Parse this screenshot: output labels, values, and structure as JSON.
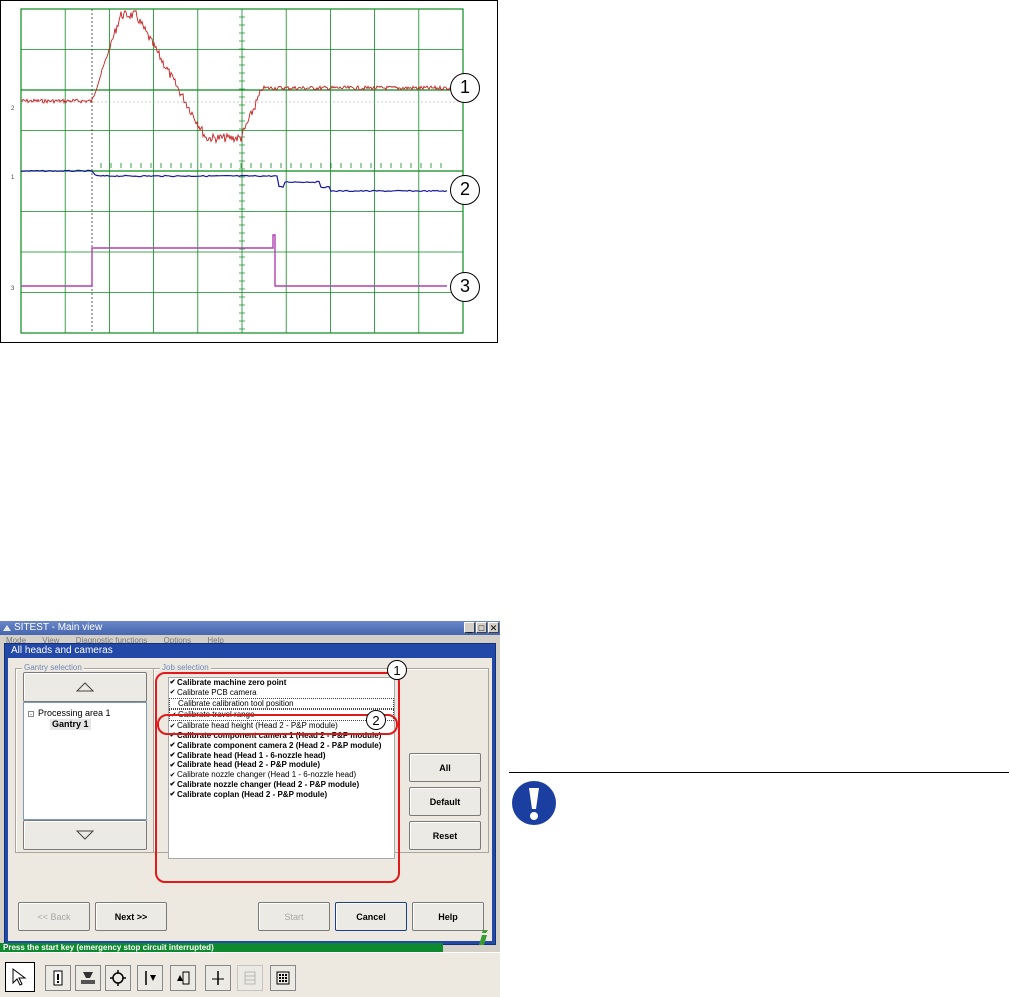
{
  "scope": {
    "callouts": [
      "1",
      "2",
      "3"
    ],
    "channel_markers": [
      "2",
      "1",
      "3"
    ],
    "colors": {
      "grid": "#0a8a1e",
      "trace1": "#c82020",
      "trace2": "#1a1aa0",
      "trace3": "#b040b0"
    }
  },
  "window": {
    "title": "SITEST - Main view",
    "menu": [
      "Mode",
      "View",
      "Diagnostic functions",
      "Options",
      "Help"
    ],
    "title_buttons": [
      "_",
      "□",
      "✕"
    ],
    "dialog": {
      "title": "All heads and cameras",
      "gantry": {
        "label": "Gantry selection",
        "up_icon": "triangle-up-icon",
        "down_icon": "triangle-down-icon",
        "tree_parent": "Processing area 1",
        "tree_child": "Gantry 1"
      },
      "jobs": {
        "label": "Job selection",
        "items": [
          {
            "label": "Calibrate machine zero point",
            "checked": true,
            "bold": true
          },
          {
            "label": "Calibrate PCB camera",
            "checked": true,
            "bold": false
          },
          {
            "label": "Calibrate calibration tool position",
            "checked": false,
            "bold": false
          },
          {
            "label": "Calibrate travel range",
            "checked": true,
            "bold": false
          },
          {
            "label": "Calibrate head height (Head 2 - P&P module)",
            "checked": true,
            "bold": false
          },
          {
            "label": "Calibrate component camera 1 (Head 2 - P&P module)",
            "checked": true,
            "bold": true
          },
          {
            "label": "Calibrate component camera 2 (Head 2 - P&P module)",
            "checked": true,
            "bold": true
          },
          {
            "label": "Calibrate head (Head 1 - 6-nozzle head)",
            "checked": true,
            "bold": true
          },
          {
            "label": "Calibrate head (Head 2 - P&P module)",
            "checked": true,
            "bold": true
          },
          {
            "label": "Calibrate nozzle changer (Head 1 - 6-nozzle head)",
            "checked": true,
            "bold": false
          },
          {
            "label": "Calibrate nozzle changer (Head 2 - P&P module)",
            "checked": true,
            "bold": true
          },
          {
            "label": "Calibrate coplan (Head 2 - P&P module)",
            "checked": true,
            "bold": true
          }
        ]
      },
      "side_buttons": [
        "All",
        "Default",
        "Reset"
      ],
      "bottom_buttons": {
        "back": "<< Back",
        "next": "Next >>",
        "start": "Start",
        "cancel": "Cancel",
        "help": "Help"
      },
      "callouts": [
        "1",
        "2"
      ]
    },
    "status": "Press the start key (emergency stop circuit interrupted)",
    "info_icon": "info-i-icon",
    "toolbar_icons": [
      "pointer-icon",
      "warning-card-icon",
      "conveyor-icon",
      "gear-icon",
      "axis-down-icon",
      "axis-up-icon",
      "axis-center-icon",
      "grid-disabled-icon",
      "keypad-icon"
    ]
  },
  "note": {
    "icon": "exclamation-icon",
    "color": "#1a3fa0"
  }
}
